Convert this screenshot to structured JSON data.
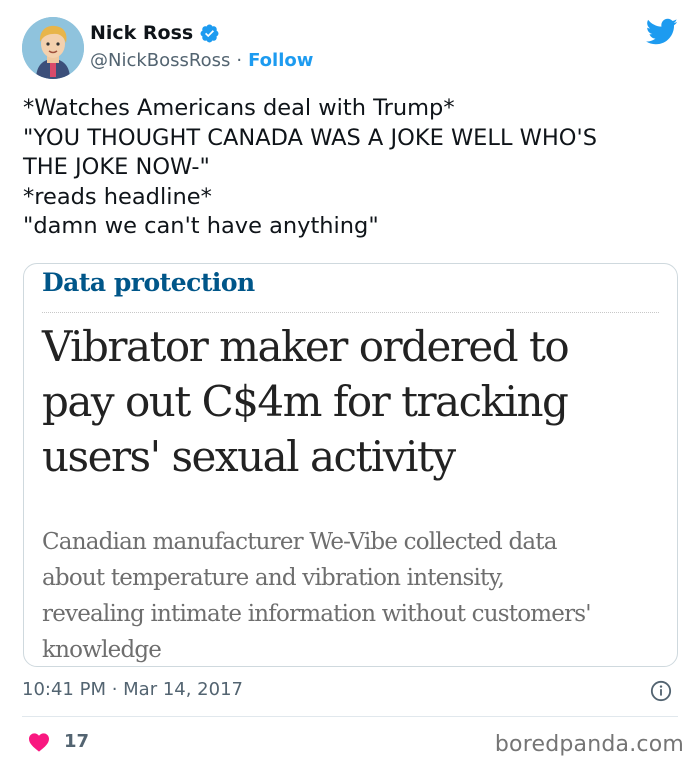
{
  "author": {
    "name": "Nick Ross",
    "handle": "@NickBossRoss",
    "separator": "·",
    "follow_label": "Follow",
    "verified": true
  },
  "tweet": {
    "text": "*Watches Americans deal with Trump*\n\"YOU THOUGHT CANADA WAS A JOKE WELL WHO'S\nTHE JOKE NOW-\"\n*reads headline*\n\"damn we can't have anything\""
  },
  "card": {
    "kicker": "Data protection",
    "headline": "Vibrator maker ordered to\npay out C$4m for tracking\nusers' sexual activity",
    "standfirst": "Canadian manufacturer We-Vibe collected data\nabout temperature and vibration intensity,\nrevealing intimate information without customers'\nknowledge"
  },
  "meta": {
    "timestamp": "10:41 PM · Mar 14, 2017",
    "like_count": "17"
  },
  "watermark": "boredpanda.com",
  "colors": {
    "accent": "#1d9bf0",
    "kicker": "#005689",
    "heart": "#f91880"
  },
  "icons": {
    "verified": "verified-badge-icon",
    "logo": "twitter-bird-icon",
    "info": "info-icon",
    "like": "heart-icon"
  }
}
